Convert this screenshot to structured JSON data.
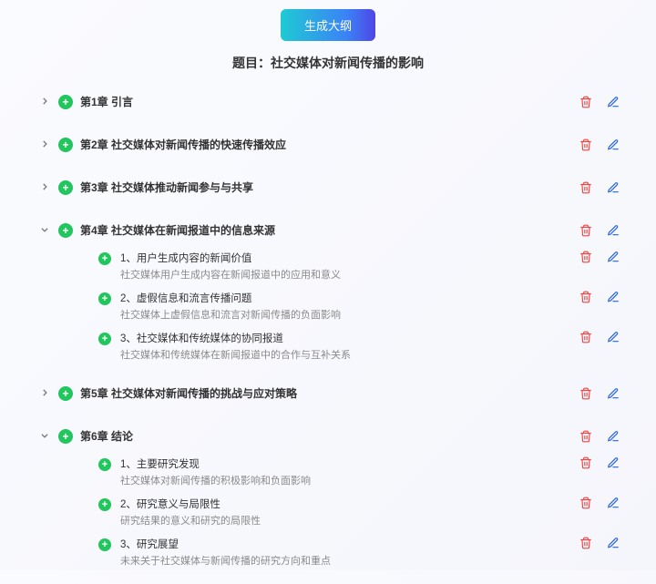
{
  "generate_button": "生成大纲",
  "title_prefix": "题目：",
  "title_text": "社交媒体对新闻传播的影响",
  "icons": {
    "delete": "delete-icon",
    "edit": "edit-icon",
    "add": "add-icon",
    "chevron_right": "chevron-right-icon",
    "chevron_down": "chevron-down-icon"
  },
  "colors": {
    "delete": "#ef4444",
    "edit": "#2563eb",
    "add_bg": "#22c55e"
  },
  "chapters": [
    {
      "id": 1,
      "expanded": false,
      "label": "第1章 引言",
      "subs": []
    },
    {
      "id": 2,
      "expanded": false,
      "label": "第2章 社交媒体对新闻传播的快速传播效应",
      "subs": []
    },
    {
      "id": 3,
      "expanded": false,
      "label": "第3章 社交媒体推动新闻参与与共享",
      "subs": []
    },
    {
      "id": 4,
      "expanded": true,
      "label": "第4章 社交媒体在新闻报道中的信息来源",
      "subs": [
        {
          "title": "1、用户生成内容的新闻价值",
          "desc": "社交媒体用户生成内容在新闻报道中的应用和意义"
        },
        {
          "title": "2、虚假信息和流言传播问题",
          "desc": "社交媒体上虚假信息和流言对新闻传播的负面影响"
        },
        {
          "title": "3、社交媒体和传统媒体的协同报道",
          "desc": "社交媒体和传统媒体在新闻报道中的合作与互补关系"
        }
      ]
    },
    {
      "id": 5,
      "expanded": false,
      "label": "第5章 社交媒体对新闻传播的挑战与应对策略",
      "subs": []
    },
    {
      "id": 6,
      "expanded": true,
      "label": "第6章 结论",
      "subs": [
        {
          "title": "1、主要研究发现",
          "desc": "社交媒体对新闻传播的积极影响和负面影响"
        },
        {
          "title": "2、研究意义与局限性",
          "desc": "研究结果的意义和研究的局限性"
        },
        {
          "title": "3、研究展望",
          "desc": "未来关于社交媒体与新闻传播的研究方向和重点"
        }
      ]
    }
  ]
}
